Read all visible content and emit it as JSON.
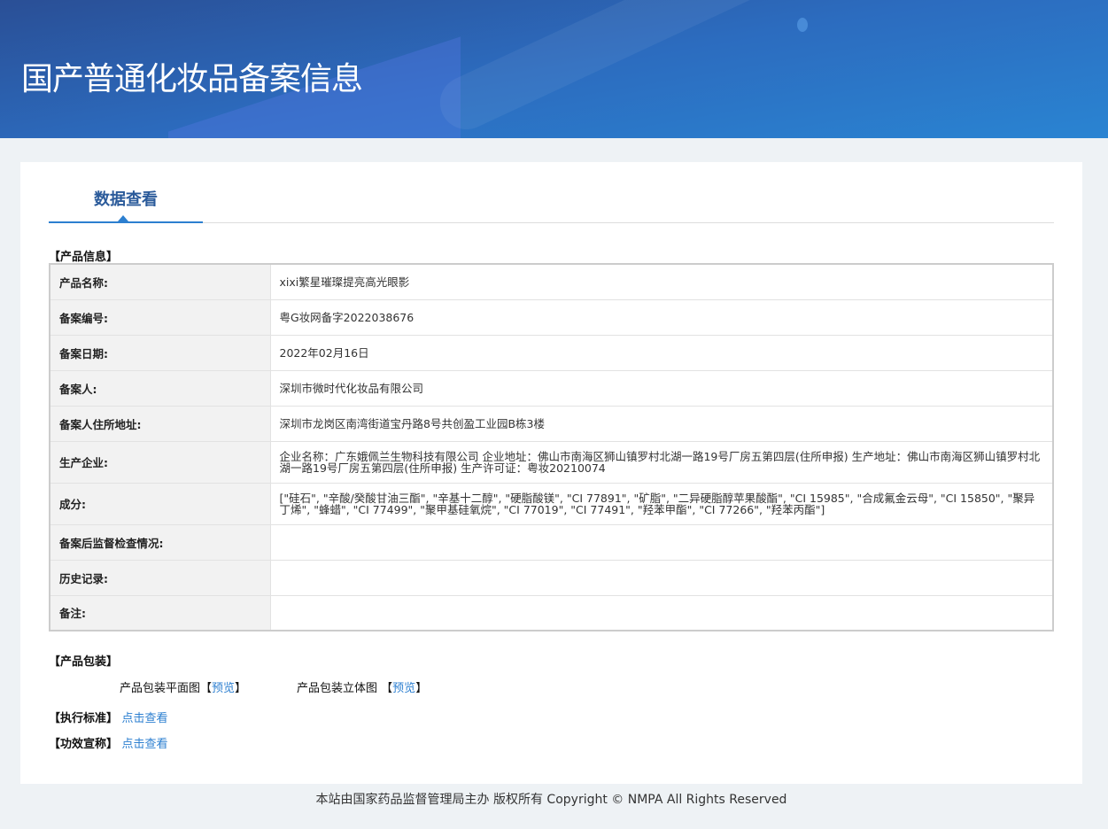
{
  "header": {
    "title": "国产普通化妆品备案信息"
  },
  "tab": "数据查看",
  "product_info": {
    "section": "【产品信息】",
    "rows": [
      {
        "label": "产品名称:",
        "value": "xixi繁星璀璨提亮高光眼影"
      },
      {
        "label": "备案编号:",
        "value": "粤G妆网备字2022038676"
      },
      {
        "label": "备案日期:",
        "value": "2022年02月16日"
      },
      {
        "label": "备案人:",
        "value": "深圳市微时代化妆品有限公司"
      },
      {
        "label": "备案人住所地址:",
        "value": "深圳市龙岗区南湾街道宝丹路8号共创盈工业园B栋3楼"
      },
      {
        "label": "生产企业:",
        "value": "企业名称：广东娥佩兰生物科技有限公司 企业地址：佛山市南海区狮山镇罗村北湖一路19号厂房五第四层(住所申报) 生产地址：佛山市南海区狮山镇罗村北湖一路19号厂房五第四层(住所申报) 生产许可证：粤妆20210074"
      },
      {
        "label": "成分:",
        "value": "[\"硅石\", \"辛酸/癸酸甘油三酯\", \"辛基十二醇\", \"硬脂酸镁\", \"CI 77891\", \"矿脂\", \"二异硬脂醇苹果酸酯\", \"CI 15985\", \"合成氟金云母\", \"CI 15850\", \"聚异丁烯\", \"蜂蜡\", \"CI 77499\", \"聚甲基硅氧烷\", \"CI 77019\", \"CI 77491\", \"羟苯甲酯\", \"CI 77266\", \"羟苯丙酯\"]"
      },
      {
        "label": "备案后监督检查情况:",
        "value": ""
      },
      {
        "label": "历史记录:",
        "value": ""
      },
      {
        "label": "备注:",
        "value": ""
      }
    ]
  },
  "packaging": {
    "section": "【产品包装】",
    "flat": "产品包装平面图",
    "solid": "产品包装立体图",
    "open": "【",
    "preview": "预览",
    "close": "】"
  },
  "standard": {
    "label": "【执行标准】",
    "link": "点击查看"
  },
  "efficacy": {
    "label": "【功效宣称】",
    "link": "点击查看"
  },
  "footer": "本站由国家药品监督管理局主办 版权所有 Copyright © NMPA All Rights Reserved"
}
